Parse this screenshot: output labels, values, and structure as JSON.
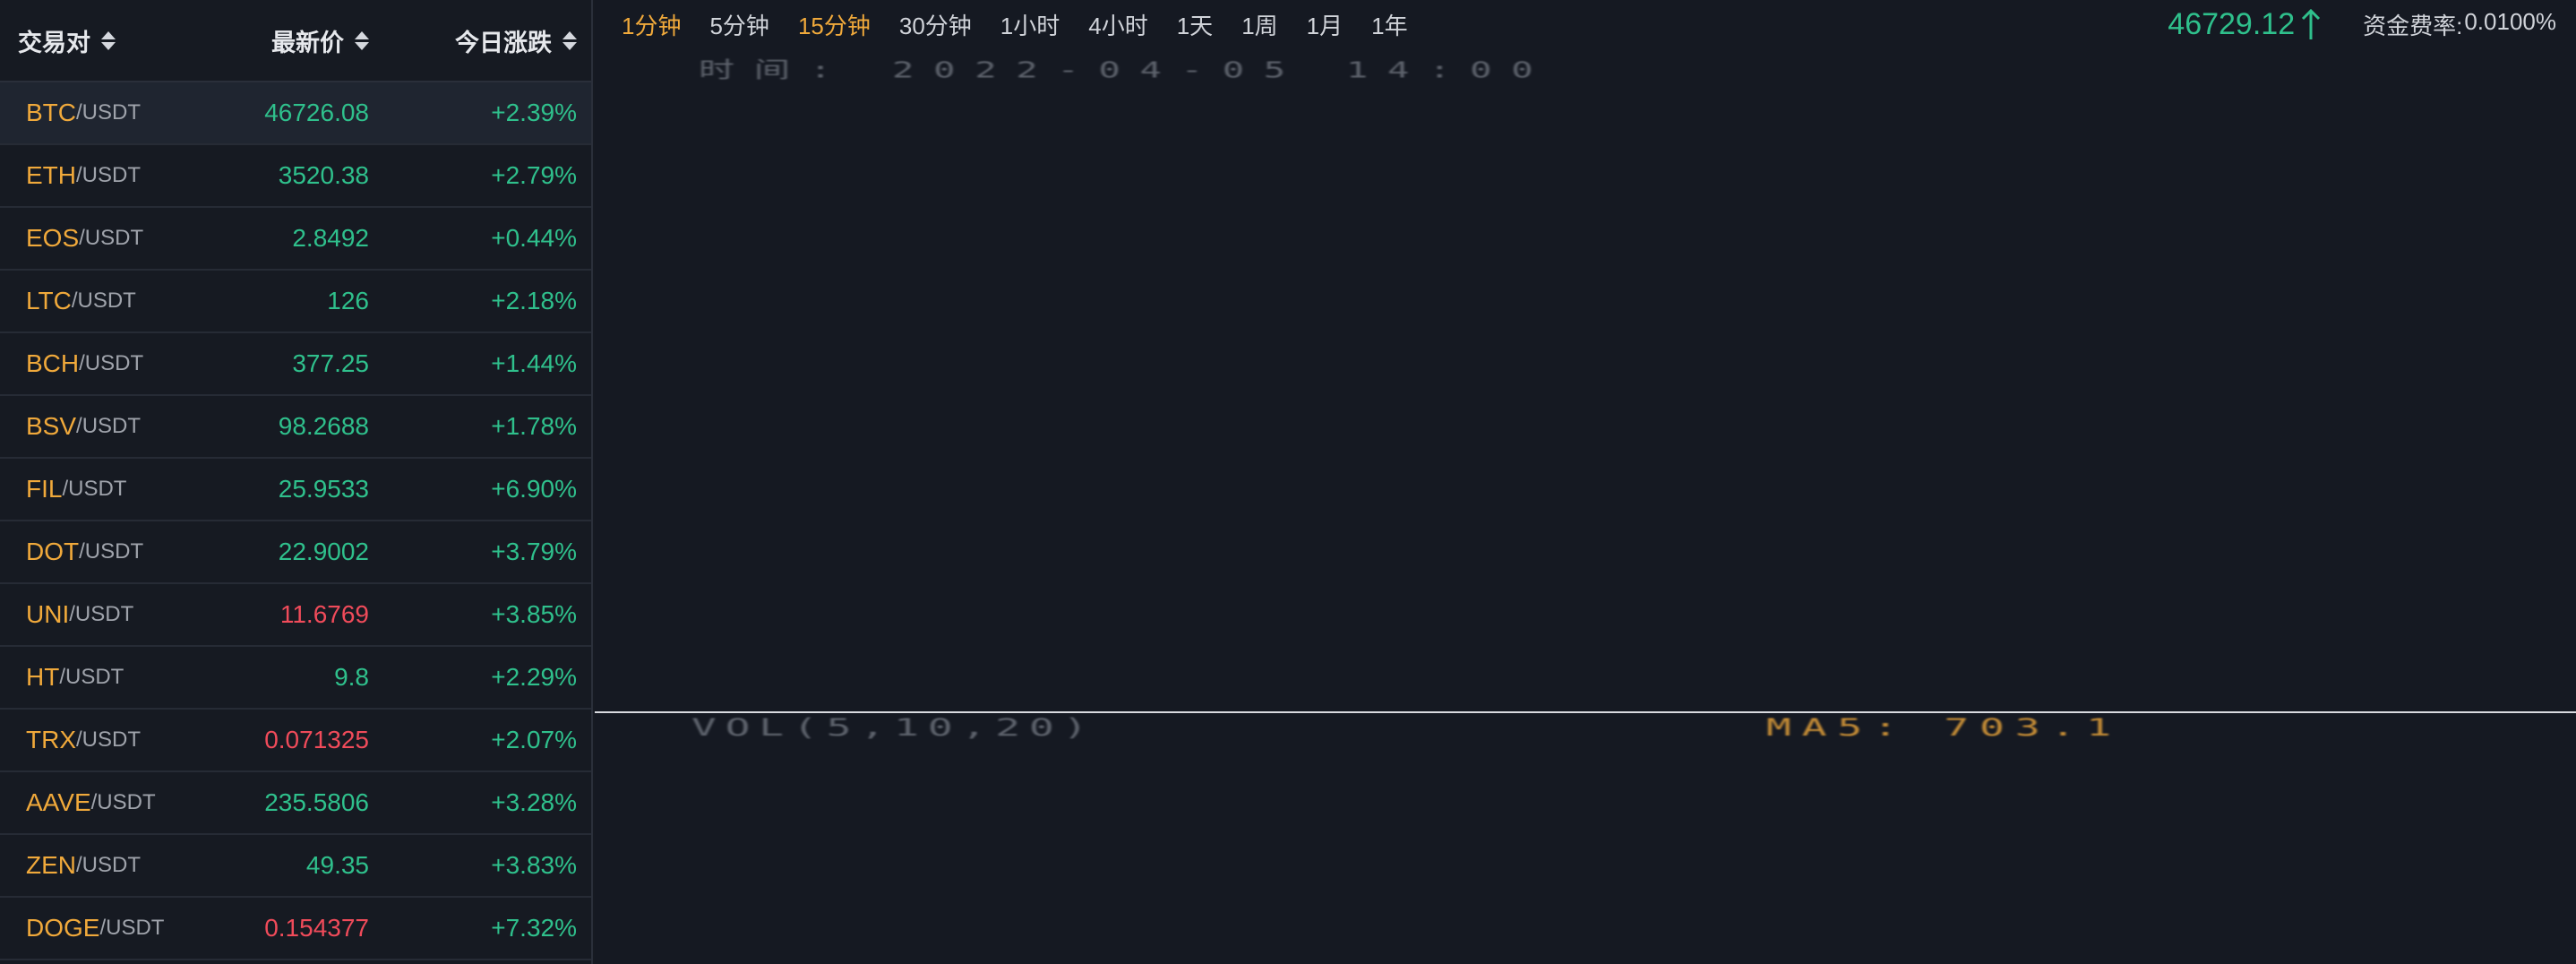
{
  "market": {
    "headers": {
      "pair": "交易对",
      "price": "最新价",
      "change": "今日涨跌"
    },
    "rows": [
      {
        "base": "BTC",
        "quote": "/USDT",
        "price": "46726.08",
        "price_dir": "up",
        "change": "+2.39%"
      },
      {
        "base": "ETH",
        "quote": "/USDT",
        "price": "3520.38",
        "price_dir": "up",
        "change": "+2.79%"
      },
      {
        "base": "EOS",
        "quote": "/USDT",
        "price": "2.8492",
        "price_dir": "up",
        "change": "+0.44%"
      },
      {
        "base": "LTC",
        "quote": "/USDT",
        "price": "126",
        "price_dir": "up",
        "change": "+2.18%"
      },
      {
        "base": "BCH",
        "quote": "/USDT",
        "price": "377.25",
        "price_dir": "up",
        "change": "+1.44%"
      },
      {
        "base": "BSV",
        "quote": "/USDT",
        "price": "98.2688",
        "price_dir": "up",
        "change": "+1.78%"
      },
      {
        "base": "FIL",
        "quote": "/USDT",
        "price": "25.9533",
        "price_dir": "up",
        "change": "+6.90%"
      },
      {
        "base": "DOT",
        "quote": "/USDT",
        "price": "22.9002",
        "price_dir": "up",
        "change": "+3.79%"
      },
      {
        "base": "UNI",
        "quote": "/USDT",
        "price": "11.6769",
        "price_dir": "down",
        "change": "+3.85%"
      },
      {
        "base": "HT",
        "quote": "/USDT",
        "price": "9.8",
        "price_dir": "up",
        "change": "+2.29%"
      },
      {
        "base": "TRX",
        "quote": "/USDT",
        "price": "0.071325",
        "price_dir": "down",
        "change": "+2.07%"
      },
      {
        "base": "AAVE",
        "quote": "/USDT",
        "price": "235.5806",
        "price_dir": "up",
        "change": "+3.28%"
      },
      {
        "base": "ZEN",
        "quote": "/USDT",
        "price": "49.35",
        "price_dir": "up",
        "change": "+3.83%"
      },
      {
        "base": "DOGE",
        "quote": "/USDT",
        "price": "0.154377",
        "price_dir": "down",
        "change": "+7.32%"
      }
    ]
  },
  "chart": {
    "intervals": [
      "1分钟",
      "5分钟",
      "15分钟",
      "30分钟",
      "1小时",
      "4小时",
      "1天",
      "1周",
      "1月",
      "1年"
    ],
    "highlighted_intervals": [
      0,
      2
    ],
    "last_price": "46729.12",
    "last_price_icon": "arrow-up-icon",
    "funding_label": "资金费率:",
    "funding_value": "0.0100%",
    "time_label": "时间: 2022-04-05 14:00",
    "vol_label": "VOL(5,10,20)",
    "ma5_label": "MA5: 703.1"
  },
  "colors": {
    "background": "#161a22",
    "base_symbol": "#f0a93b",
    "up": "#2fc08c",
    "down": "#f04b5a",
    "highlight": "#f0a93b"
  }
}
